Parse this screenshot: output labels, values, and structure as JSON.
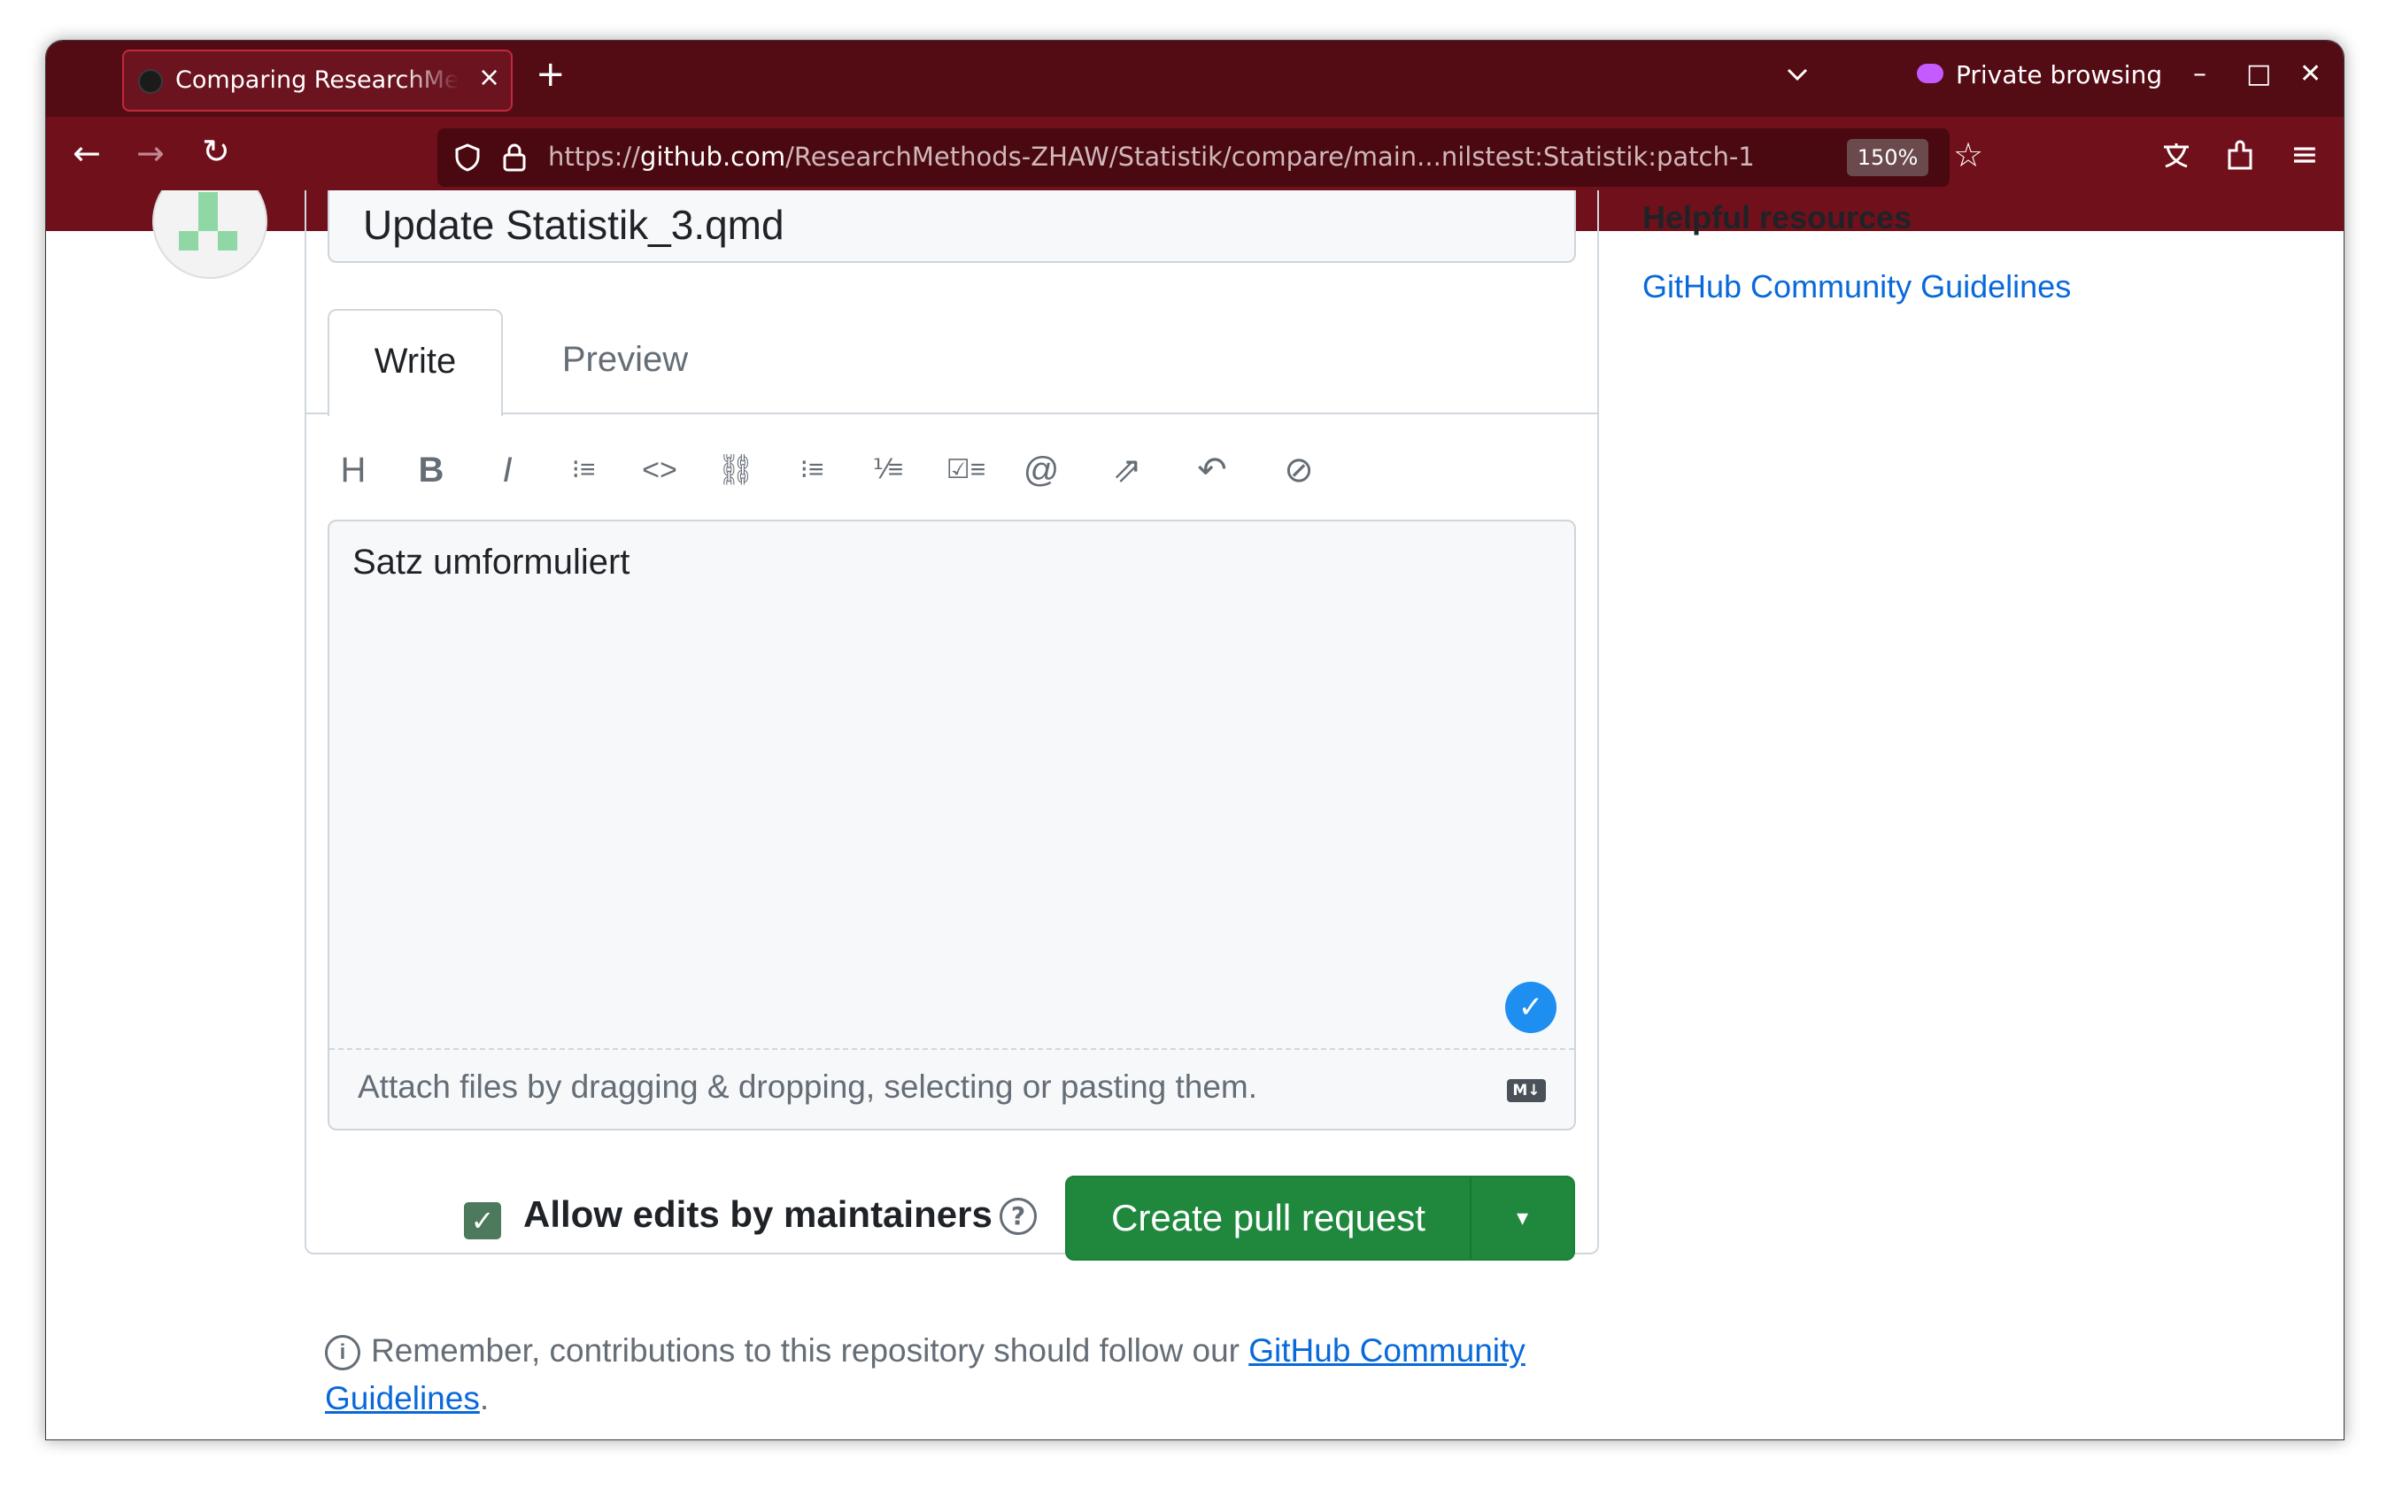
{
  "browser": {
    "tab_title": "Comparing ResearchMethods-ZHAW",
    "tab_close": "×",
    "new_tab": "+",
    "tab_list": "⌄",
    "private_label": "Private browsing",
    "minimize": "–",
    "maximize": "□",
    "close": "✕",
    "back": "←",
    "forward": "→",
    "reload": "↻",
    "url_prefix": "https://",
    "url_host": "github.com",
    "url_path": "/ResearchMethods-ZHAW/Statistik/compare/main...nilstest:Statistik:patch-1",
    "zoom": "150%",
    "star": "☆",
    "menu": "≡",
    "accent_color": "#70101b"
  },
  "form": {
    "title_value": "Update Statistik_3.qmd",
    "tabs": {
      "write": "Write",
      "preview": "Preview"
    },
    "toolbar": {
      "heading": "H",
      "bold": "B",
      "italic": "I",
      "quote": "⁝≡",
      "code": "<>",
      "link": "⛓",
      "bullet_list": "⁝≡",
      "numbered_list": "⅟≡",
      "task_list": "☑≡",
      "mention": "@",
      "reference": "⇗",
      "reply": "↶",
      "slash": "⊘"
    },
    "body_value": "Satz umformuliert",
    "attach_text": "Attach files by dragging & dropping, selecting or pasting them.",
    "markdown_badge": "M↓",
    "allow_edits_label": "Allow edits by maintainers",
    "allow_edits_checked": true,
    "help_glyph": "?",
    "submit_label": "Create pull request",
    "submit_caret": "▾",
    "primary_color": "#1f883d"
  },
  "footer": {
    "info_glyph": "i",
    "remember_text": "Remember, contributions to this repository should follow our ",
    "remember_link": "GitHub Community Guidelines",
    "remember_end": "."
  },
  "sidebar": {
    "title": "Helpful resources",
    "link": "GitHub Community Guidelines"
  }
}
